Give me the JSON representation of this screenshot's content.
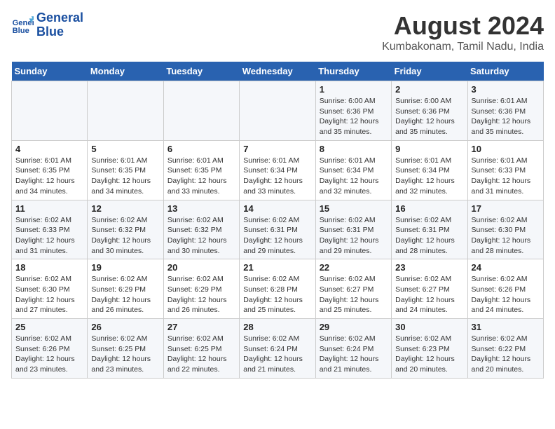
{
  "header": {
    "logo_line1": "General",
    "logo_line2": "Blue",
    "title": "August 2024",
    "subtitle": "Kumbakonam, Tamil Nadu, India"
  },
  "weekdays": [
    "Sunday",
    "Monday",
    "Tuesday",
    "Wednesday",
    "Thursday",
    "Friday",
    "Saturday"
  ],
  "weeks": [
    [
      {
        "day": "",
        "info": ""
      },
      {
        "day": "",
        "info": ""
      },
      {
        "day": "",
        "info": ""
      },
      {
        "day": "",
        "info": ""
      },
      {
        "day": "1",
        "info": "Sunrise: 6:00 AM\nSunset: 6:36 PM\nDaylight: 12 hours\nand 35 minutes."
      },
      {
        "day": "2",
        "info": "Sunrise: 6:00 AM\nSunset: 6:36 PM\nDaylight: 12 hours\nand 35 minutes."
      },
      {
        "day": "3",
        "info": "Sunrise: 6:01 AM\nSunset: 6:36 PM\nDaylight: 12 hours\nand 35 minutes."
      }
    ],
    [
      {
        "day": "4",
        "info": "Sunrise: 6:01 AM\nSunset: 6:35 PM\nDaylight: 12 hours\nand 34 minutes."
      },
      {
        "day": "5",
        "info": "Sunrise: 6:01 AM\nSunset: 6:35 PM\nDaylight: 12 hours\nand 34 minutes."
      },
      {
        "day": "6",
        "info": "Sunrise: 6:01 AM\nSunset: 6:35 PM\nDaylight: 12 hours\nand 33 minutes."
      },
      {
        "day": "7",
        "info": "Sunrise: 6:01 AM\nSunset: 6:34 PM\nDaylight: 12 hours\nand 33 minutes."
      },
      {
        "day": "8",
        "info": "Sunrise: 6:01 AM\nSunset: 6:34 PM\nDaylight: 12 hours\nand 32 minutes."
      },
      {
        "day": "9",
        "info": "Sunrise: 6:01 AM\nSunset: 6:34 PM\nDaylight: 12 hours\nand 32 minutes."
      },
      {
        "day": "10",
        "info": "Sunrise: 6:01 AM\nSunset: 6:33 PM\nDaylight: 12 hours\nand 31 minutes."
      }
    ],
    [
      {
        "day": "11",
        "info": "Sunrise: 6:02 AM\nSunset: 6:33 PM\nDaylight: 12 hours\nand 31 minutes."
      },
      {
        "day": "12",
        "info": "Sunrise: 6:02 AM\nSunset: 6:32 PM\nDaylight: 12 hours\nand 30 minutes."
      },
      {
        "day": "13",
        "info": "Sunrise: 6:02 AM\nSunset: 6:32 PM\nDaylight: 12 hours\nand 30 minutes."
      },
      {
        "day": "14",
        "info": "Sunrise: 6:02 AM\nSunset: 6:31 PM\nDaylight: 12 hours\nand 29 minutes."
      },
      {
        "day": "15",
        "info": "Sunrise: 6:02 AM\nSunset: 6:31 PM\nDaylight: 12 hours\nand 29 minutes."
      },
      {
        "day": "16",
        "info": "Sunrise: 6:02 AM\nSunset: 6:31 PM\nDaylight: 12 hours\nand 28 minutes."
      },
      {
        "day": "17",
        "info": "Sunrise: 6:02 AM\nSunset: 6:30 PM\nDaylight: 12 hours\nand 28 minutes."
      }
    ],
    [
      {
        "day": "18",
        "info": "Sunrise: 6:02 AM\nSunset: 6:30 PM\nDaylight: 12 hours\nand 27 minutes."
      },
      {
        "day": "19",
        "info": "Sunrise: 6:02 AM\nSunset: 6:29 PM\nDaylight: 12 hours\nand 26 minutes."
      },
      {
        "day": "20",
        "info": "Sunrise: 6:02 AM\nSunset: 6:29 PM\nDaylight: 12 hours\nand 26 minutes."
      },
      {
        "day": "21",
        "info": "Sunrise: 6:02 AM\nSunset: 6:28 PM\nDaylight: 12 hours\nand 25 minutes."
      },
      {
        "day": "22",
        "info": "Sunrise: 6:02 AM\nSunset: 6:27 PM\nDaylight: 12 hours\nand 25 minutes."
      },
      {
        "day": "23",
        "info": "Sunrise: 6:02 AM\nSunset: 6:27 PM\nDaylight: 12 hours\nand 24 minutes."
      },
      {
        "day": "24",
        "info": "Sunrise: 6:02 AM\nSunset: 6:26 PM\nDaylight: 12 hours\nand 24 minutes."
      }
    ],
    [
      {
        "day": "25",
        "info": "Sunrise: 6:02 AM\nSunset: 6:26 PM\nDaylight: 12 hours\nand 23 minutes."
      },
      {
        "day": "26",
        "info": "Sunrise: 6:02 AM\nSunset: 6:25 PM\nDaylight: 12 hours\nand 23 minutes."
      },
      {
        "day": "27",
        "info": "Sunrise: 6:02 AM\nSunset: 6:25 PM\nDaylight: 12 hours\nand 22 minutes."
      },
      {
        "day": "28",
        "info": "Sunrise: 6:02 AM\nSunset: 6:24 PM\nDaylight: 12 hours\nand 21 minutes."
      },
      {
        "day": "29",
        "info": "Sunrise: 6:02 AM\nSunset: 6:24 PM\nDaylight: 12 hours\nand 21 minutes."
      },
      {
        "day": "30",
        "info": "Sunrise: 6:02 AM\nSunset: 6:23 PM\nDaylight: 12 hours\nand 20 minutes."
      },
      {
        "day": "31",
        "info": "Sunrise: 6:02 AM\nSunset: 6:22 PM\nDaylight: 12 hours\nand 20 minutes."
      }
    ]
  ]
}
